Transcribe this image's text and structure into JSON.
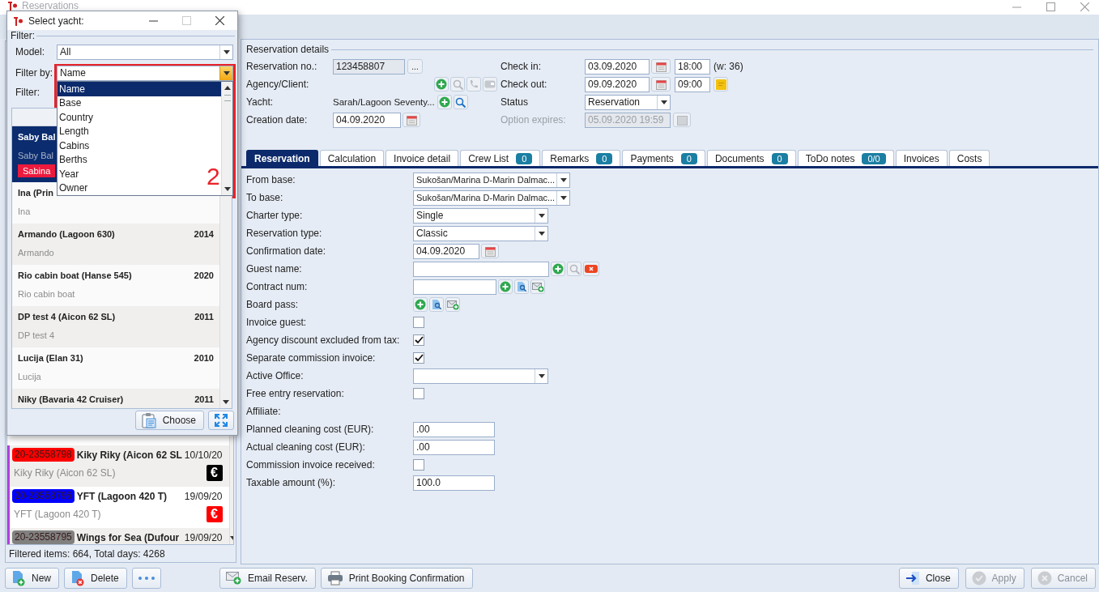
{
  "window": {
    "title": "Reservations"
  },
  "reservation_list": {
    "rows": [
      {
        "number": "20-23558798",
        "color": "#ff0000",
        "title": "Kiky Riky (Aicon 62 SL",
        "date": "10/10/20",
        "subtitle": "Kiky Riky (Aicon 62 SL)",
        "payment": {
          "label": "€",
          "color": "#000000"
        }
      },
      {
        "number": "20-23558796",
        "color": "#0000ff",
        "title": "YFT (Lagoon 420 T)",
        "date": "19/09/20",
        "subtitle": "YFT (Lagoon 420 T)",
        "payment": {
          "label": "€",
          "color": "#ff0000"
        }
      },
      {
        "number": "20-23558795",
        "color": "#808080",
        "title": "Wings for Sea (Dufour",
        "date": "19/09/20"
      }
    ],
    "status": "Filtered items: 664, Total days: 4268"
  },
  "details": {
    "title": "Reservation details",
    "left": [
      {
        "kind": "number",
        "label": "Reservation no.:",
        "value": "123458807",
        "button": "..."
      },
      {
        "kind": "agency",
        "label": "Agency/Client:"
      },
      {
        "kind": "yacht",
        "label": "Yacht:",
        "value": "Sarah/Lagoon Seventy..."
      },
      {
        "kind": "date",
        "label": "Creation date:",
        "value": "04.09.2020"
      }
    ],
    "right": [
      {
        "kind": "datetime",
        "label": "Check in:",
        "date": "03.09.2020",
        "time": "18:00",
        "week": "(w: 36)"
      },
      {
        "kind": "datetime_note",
        "label": "Check out:",
        "date": "09.09.2020",
        "time": "09:00"
      },
      {
        "kind": "select",
        "label": "Status",
        "value": "Reservation"
      },
      {
        "kind": "expiry",
        "label": "Option expires:",
        "value": "05.09.2020 19:59",
        "disabled": true
      }
    ]
  },
  "tabs": [
    {
      "label": "Reservation",
      "selected": true
    },
    {
      "label": "Calculation",
      "selected": false
    },
    {
      "label": "Invoice detail",
      "selected": false
    },
    {
      "label": "Crew List",
      "count": "0",
      "selected": false
    },
    {
      "label": "Remarks",
      "count": "0",
      "selected": false
    },
    {
      "label": "Payments",
      "count": "0",
      "selected": false
    },
    {
      "label": "Documents",
      "count": "0",
      "selected": false
    },
    {
      "label": "ToDo notes",
      "count": "0/0",
      "selected": false
    },
    {
      "label": "Invoices",
      "selected": false
    },
    {
      "label": "Costs",
      "selected": false
    }
  ],
  "form": {
    "rows": [
      {
        "kind": "base_select",
        "label": "From base:",
        "value": "Sukošan/Marina D-Marin Dalmac..."
      },
      {
        "kind": "base_select",
        "label": "To base:",
        "value": "Sukošan/Marina D-Marin Dalmac..."
      },
      {
        "kind": "select",
        "label": "Charter type:",
        "value": "Single"
      },
      {
        "kind": "select",
        "label": "Reservation type:",
        "value": "Classic"
      },
      {
        "kind": "date",
        "label": "Confirmation date:",
        "value": "04.09.2020"
      },
      {
        "kind": "guest",
        "label": "Guest name:"
      },
      {
        "kind": "contract",
        "label": "Contract num:"
      },
      {
        "kind": "board",
        "label": "Board pass:"
      },
      {
        "kind": "checkbox",
        "label": "Invoice guest:",
        "checked": false
      },
      {
        "kind": "checkbox",
        "label": "Agency discount excluded from tax:",
        "checked": true
      },
      {
        "kind": "checkbox",
        "label": "Separate commission invoice:",
        "checked": true
      },
      {
        "kind": "select",
        "label": "Active Office:"
      },
      {
        "kind": "checkbox",
        "label": "Free entry reservation:",
        "checked": false
      },
      {
        "kind": "label",
        "label": "Affiliate:"
      },
      {
        "kind": "text",
        "label": "Planned cleaning cost (EUR):",
        "value": ".00"
      },
      {
        "kind": "text",
        "label": "Actual cleaning cost (EUR):",
        "value": ".00"
      },
      {
        "kind": "checkbox",
        "label": "Commission invoice received:",
        "checked": false
      },
      {
        "kind": "text",
        "label": "Taxable amount (%):",
        "value": "100.0"
      }
    ]
  },
  "bottom_bar": {
    "left": [
      {
        "kind": "new",
        "label": "New"
      },
      {
        "kind": "delete",
        "label": "Delete"
      },
      {
        "kind": "more"
      }
    ],
    "middle": [
      {
        "kind": "email",
        "label": "Email Reserv."
      },
      {
        "kind": "print",
        "label": "Print Booking Confirmation"
      }
    ],
    "right": [
      {
        "kind": "close",
        "label": "Close",
        "disabled": false
      },
      {
        "kind": "apply",
        "label": "Apply",
        "disabled": true
      },
      {
        "kind": "cancel",
        "label": "Cancel",
        "disabled": true
      }
    ]
  },
  "dialog": {
    "title": "Select yacht:",
    "group": "Filter:",
    "model": {
      "label": "Model:",
      "value": "All"
    },
    "filter_by": {
      "label": "Filter by:",
      "value": "Name",
      "expanded": true,
      "options": [
        {
          "label": "Name",
          "selected": true
        },
        {
          "label": "Base",
          "selected": false
        },
        {
          "label": "Country",
          "selected": false
        },
        {
          "label": "Length",
          "selected": false
        },
        {
          "label": "Cabins",
          "selected": false
        },
        {
          "label": "Berths",
          "selected": false
        },
        {
          "label": "Year",
          "selected": false
        },
        {
          "label": "Owner",
          "selected": false
        }
      ]
    },
    "filter": {
      "label": "Filter:"
    },
    "yachts": [
      {
        "title": "Saby Bal",
        "subtitle": "Saby Bal",
        "tag": "Sabina",
        "selected": true
      },
      {
        "title": "Ina (Prin",
        "subtitle": "Ina",
        "selected": false
      },
      {
        "title": "Armando (Lagoon 630)",
        "year": "2014",
        "subtitle": "Armando",
        "selected": false
      },
      {
        "title": "Rio cabin boat (Hanse 545)",
        "year": "2020",
        "subtitle": "Rio cabin boat",
        "selected": false
      },
      {
        "title": "DP test 4 (Aicon 62 SL)",
        "year": "2011",
        "subtitle": "DP test 4",
        "selected": false
      },
      {
        "title": "Lucija (Elan 31)",
        "year": "2010",
        "subtitle": "Lucija",
        "selected": false
      },
      {
        "title": "Niky (Bavaria 42 Cruiser)",
        "year": "2011",
        "selected": false
      }
    ],
    "choose_button": "Choose"
  },
  "annotation": {
    "label": "2"
  }
}
